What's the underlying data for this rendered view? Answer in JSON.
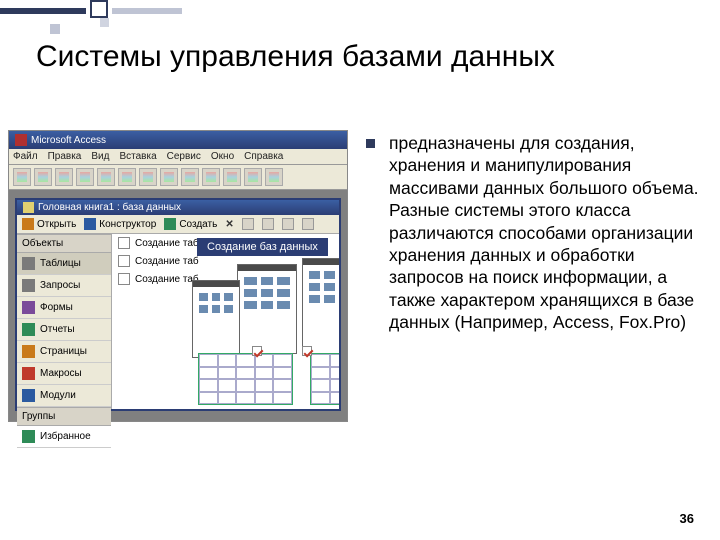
{
  "slide": {
    "title": "Системы управления базами данных",
    "page_number": "36"
  },
  "bullet": {
    "text": "предназначены для создания, хранения и манипулирования массивами данных большого объема. Разные системы этого класса различаются способами организации хранения данных и обработки запросов на поиск информации, а также характером хранящихся в базе данных (Например, Access, Fox.Pro)"
  },
  "screenshot": {
    "app_title": "Microsoft Access",
    "menubar": [
      "Файл",
      "Правка",
      "Вид",
      "Вставка",
      "Сервис",
      "Окно",
      "Справка"
    ],
    "db_window_title": "Головная книга1 : база данных",
    "db_toolbar": {
      "open": "Открыть",
      "design": "Конструктор",
      "create": "Создать"
    },
    "sidebar_header_objects": "Объекты",
    "sidebar_items": [
      "Таблицы",
      "Запросы",
      "Формы",
      "Отчеты",
      "Страницы",
      "Макросы",
      "Модули"
    ],
    "sidebar_header_groups": "Группы",
    "sidebar_group_item": "Избранное",
    "list_items": [
      "Создание таб",
      "Создание таб",
      "Создание таб"
    ],
    "banner": "Создание баз данных"
  }
}
